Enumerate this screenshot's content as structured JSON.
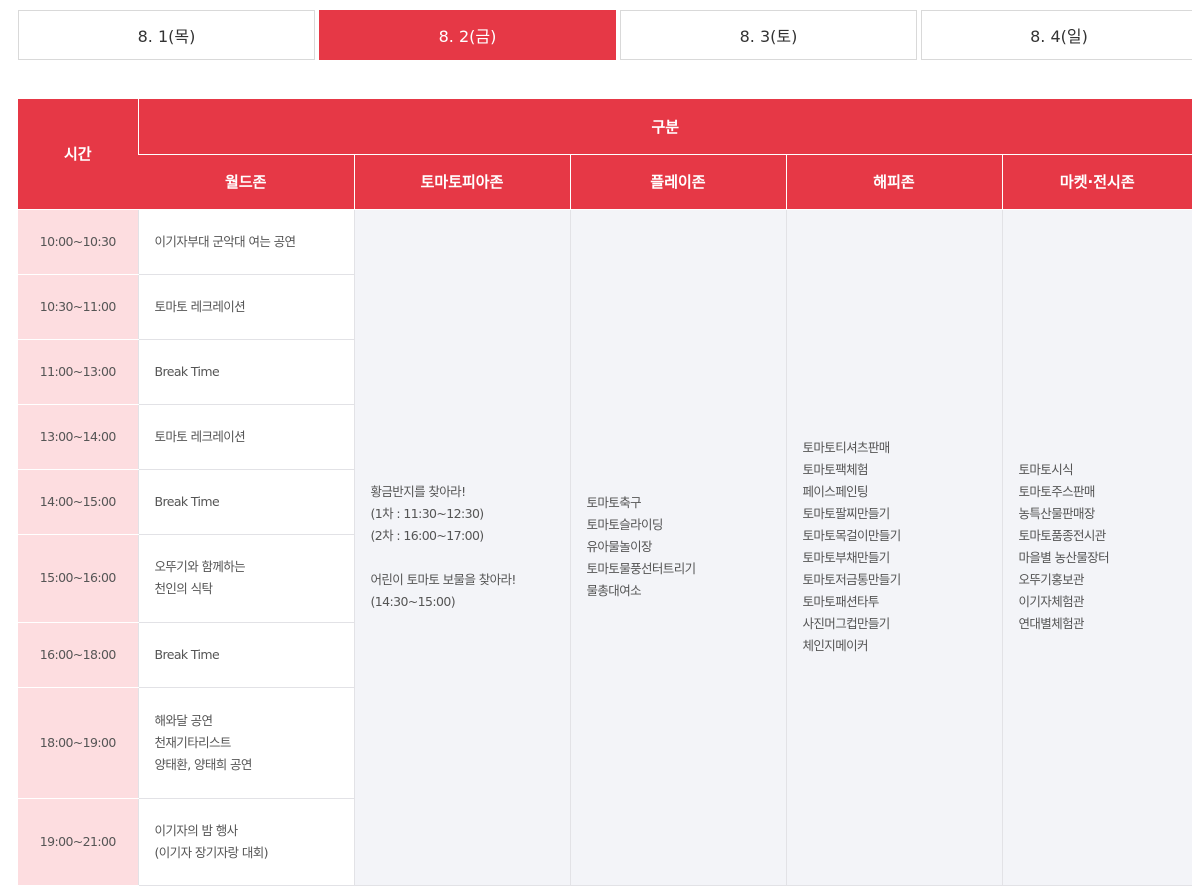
{
  "tabs": [
    {
      "label": "8. 1(목)",
      "active": false
    },
    {
      "label": "8. 2(금)",
      "active": true
    },
    {
      "label": "8. 3(토)",
      "active": false
    },
    {
      "label": "8. 4(일)",
      "active": false
    }
  ],
  "table": {
    "header_time": "시간",
    "header_category": "구분",
    "zones": [
      "월드존",
      "토마토피아존",
      "플레이존",
      "해피존",
      "마켓·전시존"
    ],
    "rows": [
      {
        "time": "10:00~10:30",
        "world": [
          "이기자부대 군악대 여는 공연"
        ]
      },
      {
        "time": "10:30~11:00",
        "world": [
          "토마토 레크레이션"
        ]
      },
      {
        "time": "11:00~13:00",
        "world": [
          "Break Time"
        ]
      },
      {
        "time": "13:00~14:00",
        "world": [
          "토마토 레크레이션"
        ]
      },
      {
        "time": "14:00~15:00",
        "world": [
          "Break Time"
        ]
      },
      {
        "time": "15:00~16:00",
        "world": [
          "오뚜기와 함께하는",
          "천인의 식탁"
        ]
      },
      {
        "time": "16:00~18:00",
        "world": [
          "Break Time"
        ]
      },
      {
        "time": "18:00~19:00",
        "world": [
          "해와달 공연",
          "천재기타리스트",
          "양태환, 양태희 공연"
        ]
      },
      {
        "time": "19:00~21:00",
        "world": [
          "이기자의 밤 행사",
          "(이기자 장기자랑 대회)"
        ]
      }
    ],
    "tomatopia": [
      "황금반지를 찾아라!",
      "(1차 : 11:30~12:30)",
      "(2차 : 16:00~17:00)",
      "",
      "어린이 토마토 보물을 찾아라!",
      "(14:30~15:00)"
    ],
    "play": [
      "토마토축구",
      "토마토슬라이딩",
      "유아물놀이장",
      "토마토물풍선터트리기",
      "물총대여소"
    ],
    "happy": [
      "토마토티셔츠판매",
      "토마토팩체험",
      "페이스페인팅",
      "토마토팔찌만들기",
      "토마토목걸이만들기",
      "토마토부채만들기",
      "토마토저금통만들기",
      "토마토패션타투",
      "사진머그컵만들기",
      "체인지메이커"
    ],
    "market": [
      "토마토시식",
      "토마토주스판매",
      "농특산물판매장",
      "토마토품종전시관",
      "마을별 농산물장터",
      "오뚜기홍보관",
      "이기자체험관",
      "연대별체험관"
    ]
  },
  "colors": {
    "accent": "#e63846",
    "time_bg": "#fddde0",
    "time_text": "#e9525f",
    "zone_bg": "#f3f4f8"
  }
}
